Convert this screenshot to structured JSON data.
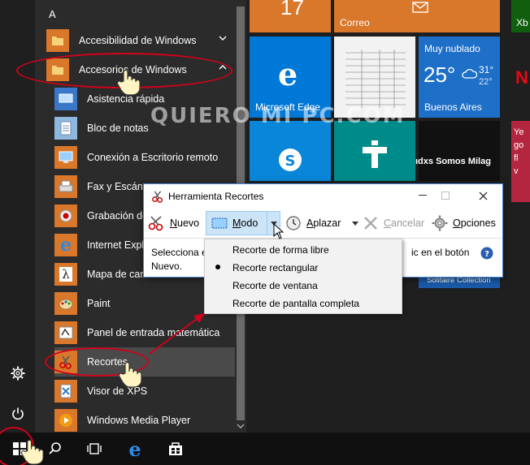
{
  "applist": {
    "letter": "A",
    "items": [
      {
        "label": "Accesibilidad de Windows",
        "icon": "folder-icon"
      },
      {
        "label": "Accesorios de Windows",
        "icon": "folder-icon"
      },
      {
        "label": "Asistencia rápida",
        "icon": "remote-assist-icon"
      },
      {
        "label": "Bloc de notas",
        "icon": "notepad-icon"
      },
      {
        "label": "Conexión a Escritorio remoto",
        "icon": "remote-desktop-icon"
      },
      {
        "label": "Fax y Escáner",
        "icon": "fax-icon"
      },
      {
        "label": "Grabación de",
        "icon": "record-icon"
      },
      {
        "label": "Internet Explo",
        "icon": "internet-explorer-icon"
      },
      {
        "label": "Mapa de caracteres",
        "icon": "charmap-icon"
      },
      {
        "label": "Paint",
        "icon": "paint-icon"
      },
      {
        "label": "Panel de entrada matemática",
        "icon": "math-input-icon"
      },
      {
        "label": "Recortes",
        "icon": "scissors-icon"
      },
      {
        "label": "Visor de XPS",
        "icon": "xps-icon"
      },
      {
        "label": "Windows Media Player",
        "icon": "media-player-icon"
      }
    ]
  },
  "tiles": {
    "calendar_num": "17",
    "correo": "Correo",
    "edge": "Microsoft Edge",
    "weather_cond": "Muy nublado",
    "weather_temp": "25°",
    "weather_hi": "31°",
    "weather_lo": "22°",
    "weather_city": "Buenos Aires",
    "news_fragment": "ıdxs Somos Milag",
    "solitaire": "Solitaire Collection",
    "xbox_fragment": "Xb",
    "side_text": "Ye\ngo\nfl\nv"
  },
  "watermark": "QUIERO MI PC.COM",
  "snip": {
    "title": "Herramienta Recortes",
    "btn_nuevo_u": "N",
    "btn_nuevo_rest": "uevo",
    "btn_modo_u": "M",
    "btn_modo_rest": "odo",
    "btn_aplazar_u": "A",
    "btn_aplazar_rest": "plazar",
    "btn_cancelar_u": "C",
    "btn_cancelar_rest": "ancelar",
    "btn_opciones_u": "O",
    "btn_opciones_rest": "pciones",
    "msg_line1": "Selecciona el",
    "msg_line1_end": "ic en el botón",
    "msg_line2": "Nuevo."
  },
  "menu": {
    "items": [
      "Recorte de forma libre",
      "Recorte rectangular",
      "Recorte de ventana",
      "Recorte de pantalla completa"
    ],
    "selected_index": 1
  },
  "colors": {
    "accent": "#d9772b",
    "annotation": "#d0021b",
    "edge_tile": "#0078d7",
    "teal_tile": "#008b8b"
  }
}
